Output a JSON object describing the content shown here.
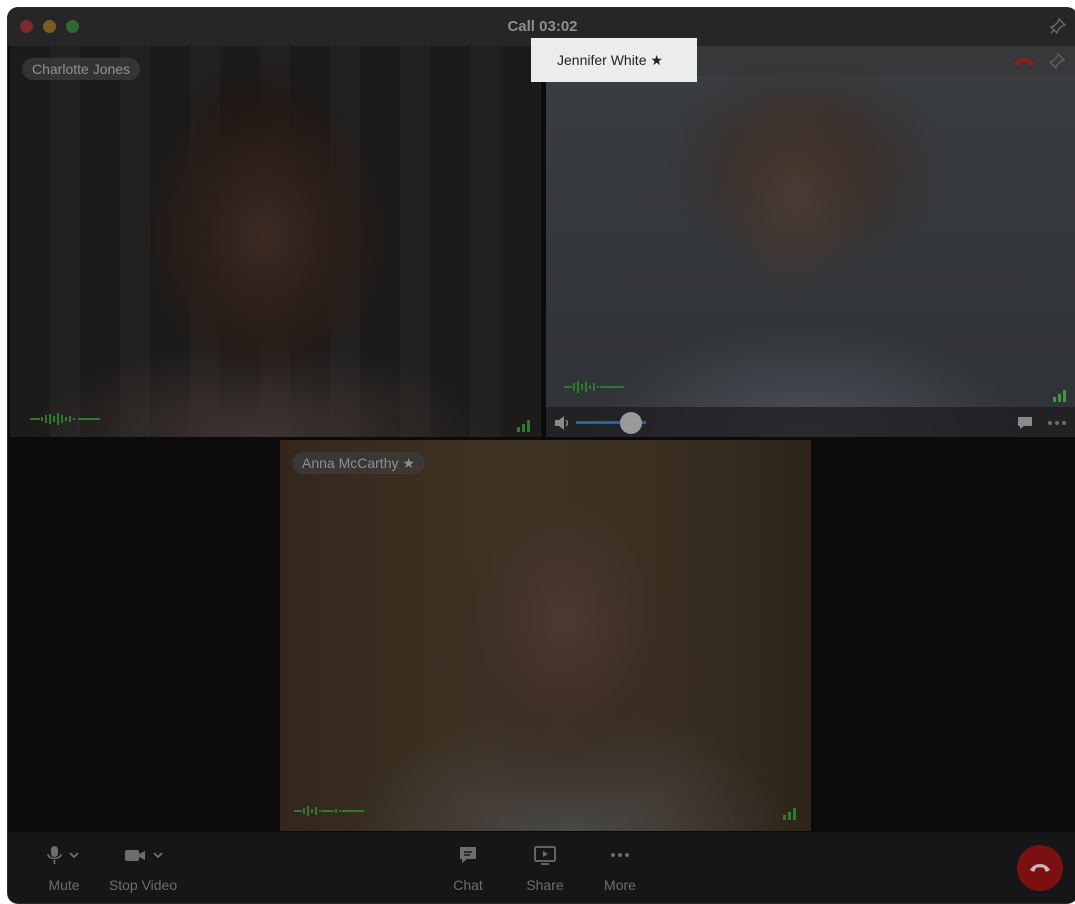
{
  "window": {
    "title": "Call 03:02"
  },
  "participants": [
    {
      "name": "Charlotte Jones"
    },
    {
      "name": "Jennifer White ★"
    },
    {
      "name": "Anna McCarthy ★"
    }
  ],
  "toolbar": {
    "mute_label": "Mute",
    "stop_video_label": "Stop Video",
    "chat_label": "Chat",
    "share_label": "Share",
    "more_label": "More"
  },
  "volume": {
    "level": 0.7
  },
  "colors": {
    "accent_blue": "#2d5f9b",
    "audio_green": "#3d9a3a",
    "end_call_red": "#b51515"
  }
}
